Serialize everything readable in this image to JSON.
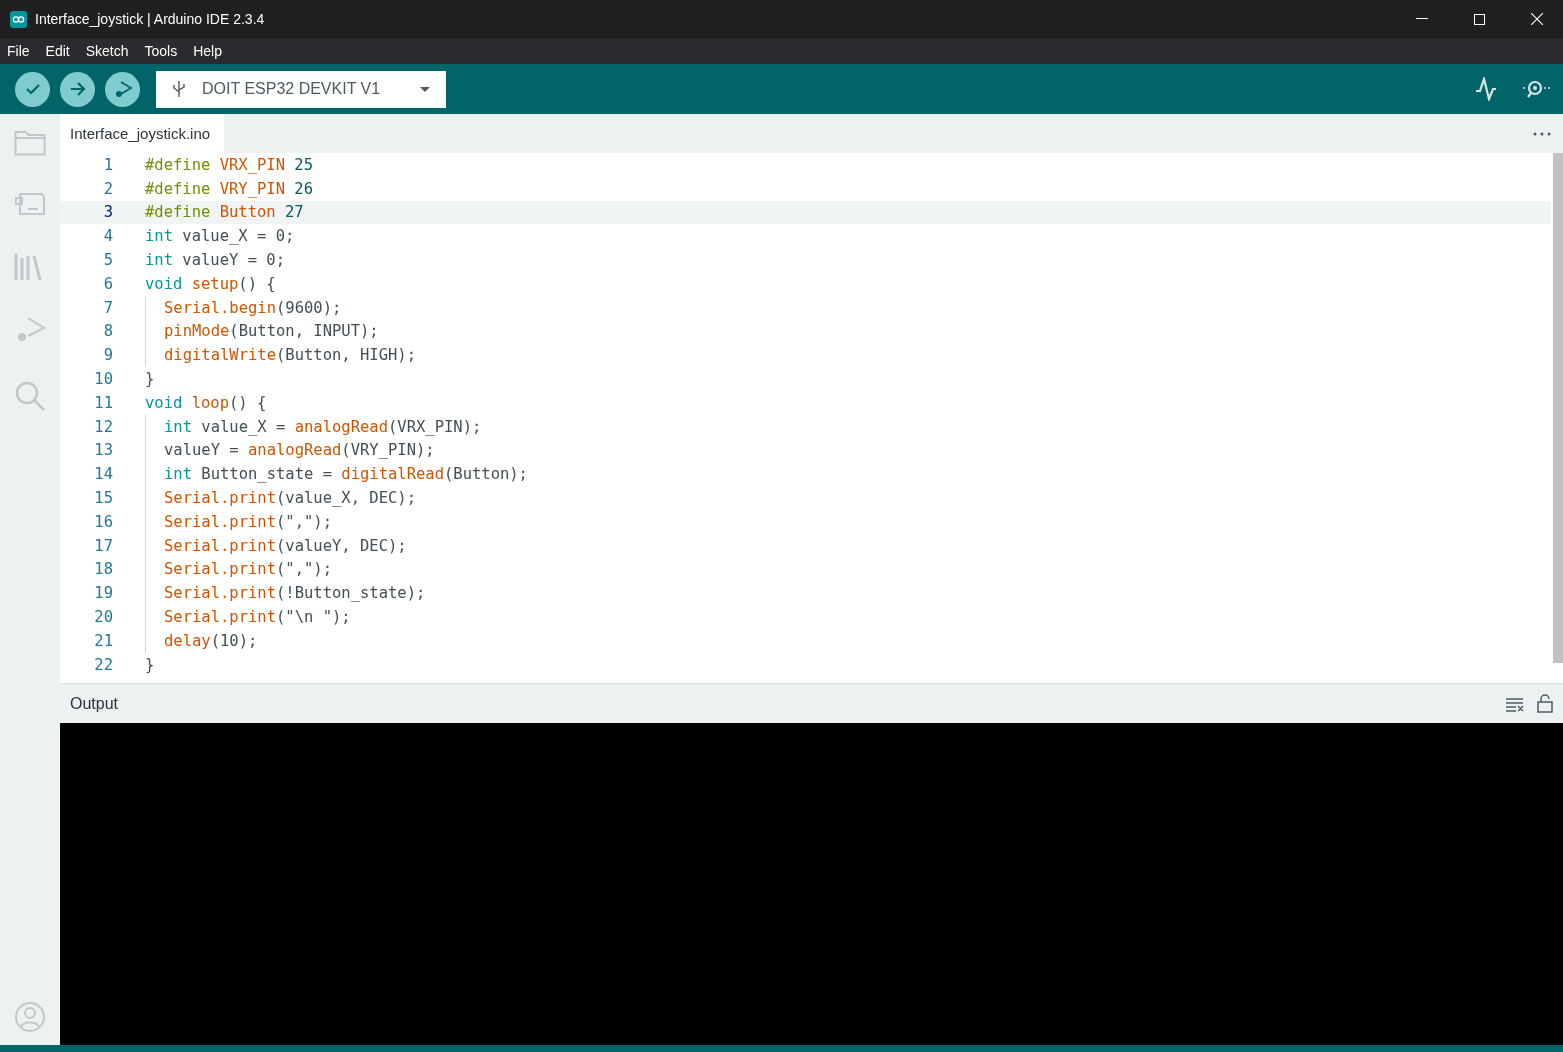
{
  "window": {
    "title": "Interface_joystick | Arduino IDE 2.3.4"
  },
  "menu": [
    "File",
    "Edit",
    "Sketch",
    "Tools",
    "Help"
  ],
  "toolbar": {
    "board": "DOIT ESP32 DEVKIT V1"
  },
  "editor": {
    "tab": {
      "label": "Interface_joystick.ino",
      "selected": true
    },
    "lines": [
      {
        "number": "1",
        "highlighted": false,
        "indented": false,
        "tokens": [
          {
            "kind": "pp",
            "text": "#define "
          },
          {
            "kind": "fn",
            "text": "VRX_PIN "
          },
          {
            "kind": "num",
            "text": "25"
          }
        ]
      },
      {
        "number": "2",
        "highlighted": false,
        "indented": false,
        "tokens": [
          {
            "kind": "pp",
            "text": "#define "
          },
          {
            "kind": "fn",
            "text": "VRY_PIN "
          },
          {
            "kind": "num",
            "text": "26"
          }
        ]
      },
      {
        "number": "3",
        "highlighted": true,
        "indented": false,
        "tokens": [
          {
            "kind": "pp",
            "text": "#define "
          },
          {
            "kind": "fn",
            "text": "Button "
          },
          {
            "kind": "num",
            "text": "27"
          }
        ]
      },
      {
        "number": "4",
        "highlighted": false,
        "indented": false,
        "tokens": [
          {
            "kind": "kw",
            "text": "int "
          },
          {
            "kind": "tx",
            "text": "value_X = 0;"
          }
        ]
      },
      {
        "number": "5",
        "highlighted": false,
        "indented": false,
        "tokens": [
          {
            "kind": "kw",
            "text": "int "
          },
          {
            "kind": "tx",
            "text": "valueY = 0;"
          }
        ]
      },
      {
        "number": "6",
        "highlighted": false,
        "indented": false,
        "tokens": [
          {
            "kind": "kw",
            "text": "void "
          },
          {
            "kind": "fn",
            "text": "setup"
          },
          {
            "kind": "tx",
            "text": "() {"
          }
        ]
      },
      {
        "number": "7",
        "highlighted": false,
        "indented": true,
        "tokens": [
          {
            "kind": "fn",
            "text": "Serial.begin"
          },
          {
            "kind": "tx",
            "text": "(9600);"
          }
        ]
      },
      {
        "number": "8",
        "highlighted": false,
        "indented": true,
        "tokens": [
          {
            "kind": "fn",
            "text": "pinMode"
          },
          {
            "kind": "tx",
            "text": "(Button, INPUT);"
          }
        ]
      },
      {
        "number": "9",
        "highlighted": false,
        "indented": true,
        "tokens": [
          {
            "kind": "fn",
            "text": "digitalWrite"
          },
          {
            "kind": "tx",
            "text": "(Button, HIGH);"
          }
        ]
      },
      {
        "number": "10",
        "highlighted": false,
        "indented": false,
        "tokens": [
          {
            "kind": "tx",
            "text": "}"
          }
        ]
      },
      {
        "number": "11",
        "highlighted": false,
        "indented": false,
        "tokens": [
          {
            "kind": "kw",
            "text": "void "
          },
          {
            "kind": "fn",
            "text": "loop"
          },
          {
            "kind": "tx",
            "text": "() {"
          }
        ]
      },
      {
        "number": "12",
        "highlighted": false,
        "indented": true,
        "tokens": [
          {
            "kind": "kw",
            "text": "int "
          },
          {
            "kind": "tx",
            "text": "value_X = "
          },
          {
            "kind": "fn",
            "text": "analogRead"
          },
          {
            "kind": "tx",
            "text": "(VRX_PIN);"
          }
        ]
      },
      {
        "number": "13",
        "highlighted": false,
        "indented": true,
        "tokens": [
          {
            "kind": "tx",
            "text": "valueY = "
          },
          {
            "kind": "fn",
            "text": "analogRead"
          },
          {
            "kind": "tx",
            "text": "(VRY_PIN);"
          }
        ]
      },
      {
        "number": "14",
        "highlighted": false,
        "indented": true,
        "tokens": [
          {
            "kind": "kw",
            "text": "int "
          },
          {
            "kind": "tx",
            "text": "Button_state = "
          },
          {
            "kind": "fn",
            "text": "digitalRead"
          },
          {
            "kind": "tx",
            "text": "(Button);"
          }
        ]
      },
      {
        "number": "15",
        "highlighted": false,
        "indented": true,
        "tokens": [
          {
            "kind": "fn",
            "text": "Serial.print"
          },
          {
            "kind": "tx",
            "text": "(value_X, DEC);"
          }
        ]
      },
      {
        "number": "16",
        "highlighted": false,
        "indented": true,
        "tokens": [
          {
            "kind": "fn",
            "text": "Serial.print"
          },
          {
            "kind": "tx",
            "text": "(\",\");"
          }
        ]
      },
      {
        "number": "17",
        "highlighted": false,
        "indented": true,
        "tokens": [
          {
            "kind": "fn",
            "text": "Serial.print"
          },
          {
            "kind": "tx",
            "text": "(valueY, DEC);"
          }
        ]
      },
      {
        "number": "18",
        "highlighted": false,
        "indented": true,
        "tokens": [
          {
            "kind": "fn",
            "text": "Serial.print"
          },
          {
            "kind": "tx",
            "text": "(\",\");"
          }
        ]
      },
      {
        "number": "19",
        "highlighted": false,
        "indented": true,
        "tokens": [
          {
            "kind": "fn",
            "text": "Serial.print"
          },
          {
            "kind": "tx",
            "text": "(!Button_state);"
          }
        ]
      },
      {
        "number": "20",
        "highlighted": false,
        "indented": true,
        "tokens": [
          {
            "kind": "fn",
            "text": "Serial.print"
          },
          {
            "kind": "tx",
            "text": "(\"\\n \");"
          }
        ]
      },
      {
        "number": "21",
        "highlighted": false,
        "indented": true,
        "tokens": [
          {
            "kind": "fn",
            "text": "delay"
          },
          {
            "kind": "tx",
            "text": "(10);"
          }
        ]
      },
      {
        "number": "22",
        "highlighted": false,
        "indented": false,
        "tokens": [
          {
            "kind": "tx",
            "text": "}"
          }
        ]
      }
    ]
  },
  "output": {
    "title": "Output"
  }
}
